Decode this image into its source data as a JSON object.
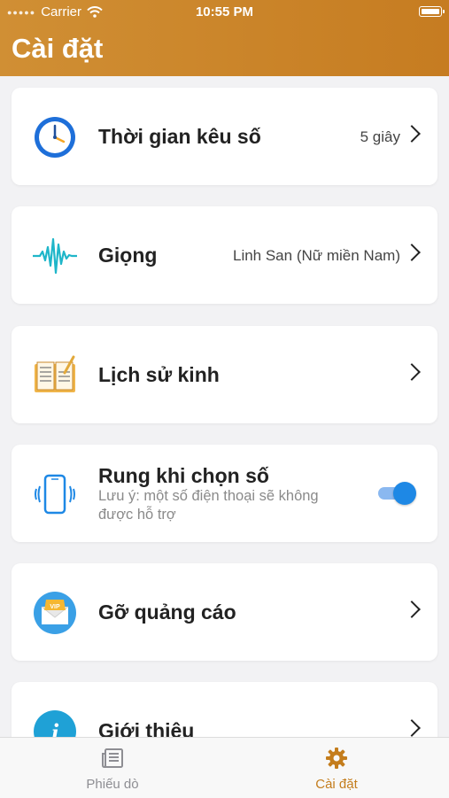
{
  "status_bar": {
    "carrier": "Carrier",
    "time": "10:55 PM"
  },
  "header": {
    "title": "Cài đặt"
  },
  "settings": [
    {
      "label": "Thời gian kêu số",
      "value": "5 giây",
      "icon": "clock-icon"
    },
    {
      "label": "Giọng",
      "value": "Linh San (Nữ miền Nam)",
      "icon": "voice-wave-icon"
    },
    {
      "label": "Lịch sử kinh",
      "value": "",
      "icon": "book-icon"
    },
    {
      "label": "Rung khi chọn số",
      "note": "Lưu ý: một số điện thoại sẽ không được hỗ trợ",
      "toggle_on": true,
      "icon": "vibrate-phone-icon"
    },
    {
      "label": "Gỡ quảng cáo",
      "value": "",
      "icon": "vip-ad-icon",
      "badge": "VIP"
    },
    {
      "label": "Giới thiệu",
      "value": "",
      "icon": "info-icon",
      "icon_glyph": "i"
    }
  ],
  "tabbar": {
    "tabs": [
      {
        "label": "Phiếu dò",
        "icon": "newspaper-icon",
        "active": false
      },
      {
        "label": "Cài đặt",
        "icon": "gear-icon",
        "active": true
      }
    ]
  },
  "colors": {
    "header": "#c98328",
    "active_tab": "#c47d1d",
    "toggle": "#1e88e5"
  }
}
